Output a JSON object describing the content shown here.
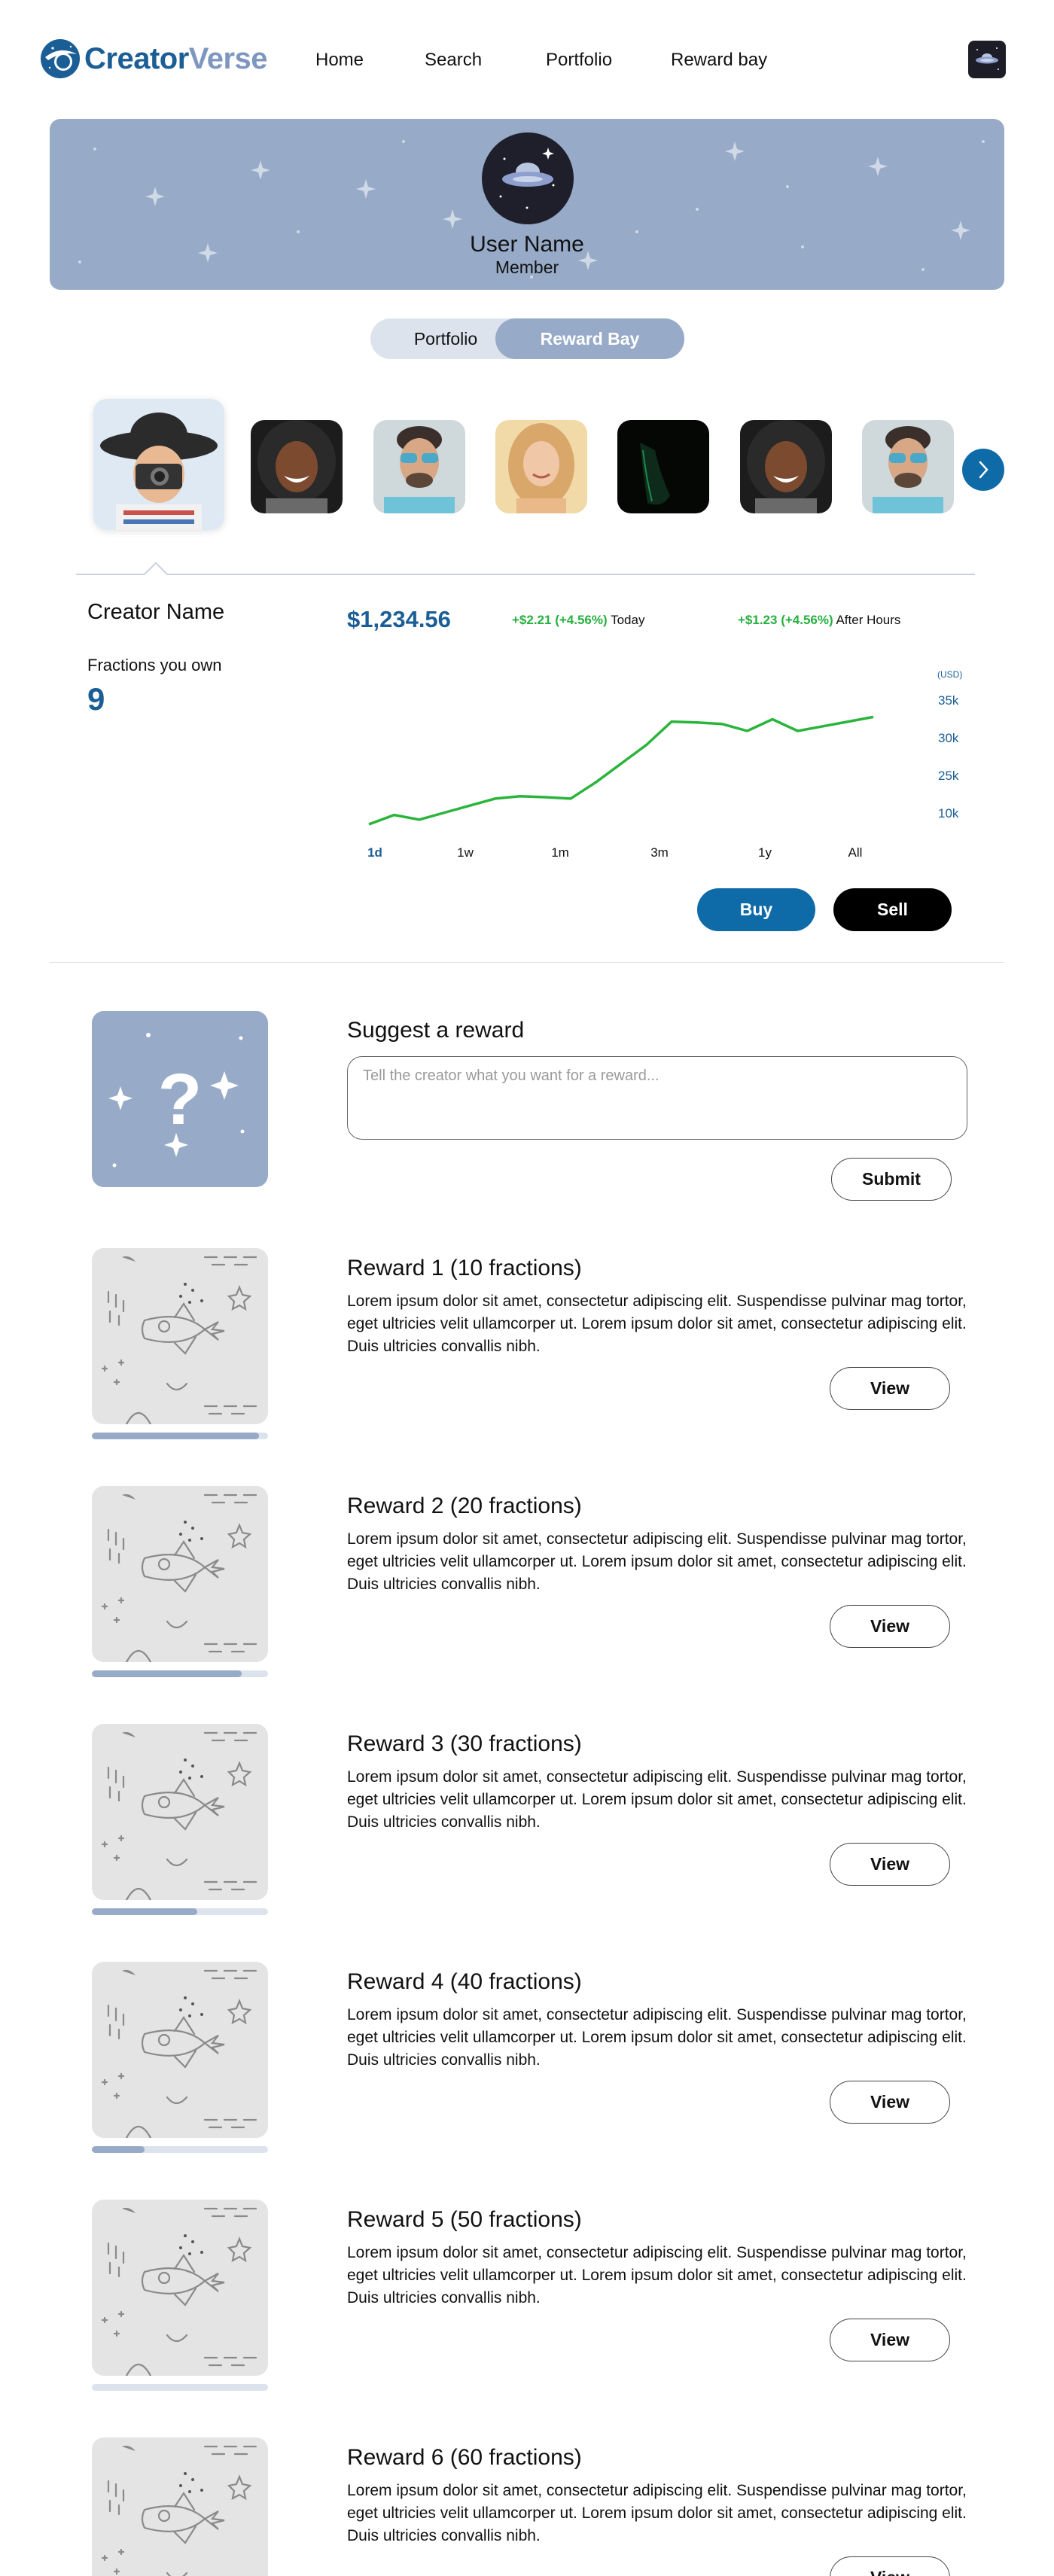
{
  "brand": {
    "name_part1": "Creator",
    "name_part2": "Verse",
    "logo_icon": "planet-logo-icon"
  },
  "nav": [
    {
      "label": "Home"
    },
    {
      "label": "Search"
    },
    {
      "label": "Portfolio"
    },
    {
      "label": "Reward bay"
    }
  ],
  "profile": {
    "name": "User Name",
    "role": "Member",
    "avatar_icon": "ufo-icon"
  },
  "toggle": {
    "left_label": "Portfolio",
    "right_label": "Reward Bay",
    "active": "Reward Bay"
  },
  "creators": [
    {
      "name": "creator-photographer-hat",
      "active": true
    },
    {
      "name": "creator-curly-hair-woman"
    },
    {
      "name": "creator-man-sunglasses"
    },
    {
      "name": "creator-blonde-woman"
    },
    {
      "name": "creator-dark-silhouette"
    },
    {
      "name": "creator-curly-hair-woman-2"
    },
    {
      "name": "creator-man-sunglasses-2"
    }
  ],
  "next_icon": "chevron-right-icon",
  "creator_detail": {
    "name": "Creator Name",
    "price": "$1,234.56",
    "today_change": "+$2.21 (+4.56%)",
    "today_label": "Today",
    "after_hours_change": "+$1.23 (+4.56%)",
    "after_hours_label": "After Hours",
    "fractions_label": "Fractions you own",
    "fractions_value": "9"
  },
  "chart_data": {
    "type": "line",
    "unit_label": "(USD)",
    "y_ticks": [
      "35k",
      "30k",
      "25k",
      "10k"
    ],
    "ranges": [
      "1d",
      "1w",
      "1m",
      "3m",
      "1y",
      "All"
    ],
    "active_range": "1d",
    "line_color": "#2bb43c",
    "values": [
      10,
      12,
      11,
      12.5,
      14,
      15.5,
      16,
      15.8,
      15.5,
      19,
      23,
      27,
      32,
      31.8,
      31.5,
      30,
      32.5,
      30,
      31,
      32,
      33
    ]
  },
  "actions": {
    "buy_label": "Buy",
    "sell_label": "Sell"
  },
  "suggest": {
    "title": "Suggest a reward",
    "placeholder": "Tell the creator what you want for a reward...",
    "submit_label": "Submit"
  },
  "rewards": [
    {
      "title": "Reward 1 (10 fractions)",
      "desc": "Lorem ipsum dolor sit amet, consectetur adipiscing elit. Suspendisse pulvinar mag tortor, eget ultricies velit ullamcorper ut. Lorem ipsum dolor sit amet, consectetur adipiscing elit. Duis ultricies convallis nibh.",
      "view_label": "View",
      "progress": 0.95
    },
    {
      "title": "Reward 2 (20 fractions)",
      "desc": "Lorem ipsum dolor sit amet, consectetur adipiscing elit. Suspendisse pulvinar mag tortor, eget ultricies velit ullamcorper ut. Lorem ipsum dolor sit amet, consectetur adipiscing elit. Duis ultricies convallis nibh.",
      "view_label": "View",
      "progress": 0.85
    },
    {
      "title": "Reward 3 (30 fractions)",
      "desc": "Lorem ipsum dolor sit amet, consectetur adipiscing elit. Suspendisse pulvinar mag tortor, eget ultricies velit ullamcorper ut. Lorem ipsum dolor sit amet, consectetur adipiscing elit. Duis ultricies convallis nibh.",
      "view_label": "View",
      "progress": 0.6
    },
    {
      "title": "Reward 4 (40 fractions)",
      "desc": "Lorem ipsum dolor sit amet, consectetur adipiscing elit. Suspendisse pulvinar mag tortor, eget ultricies velit ullamcorper ut. Lorem ipsum dolor sit amet, consectetur adipiscing elit. Duis ultricies convallis nibh.",
      "view_label": "View",
      "progress": 0.3
    },
    {
      "title": "Reward 5 (50 fractions)",
      "desc": "Lorem ipsum dolor sit amet, consectetur adipiscing elit. Suspendisse pulvinar mag tortor, eget ultricies velit ullamcorper ut. Lorem ipsum dolor sit amet, consectetur adipiscing elit. Duis ultricies convallis nibh.",
      "view_label": "View",
      "progress": 0.0
    },
    {
      "title": "Reward 6 (60 fractions)",
      "desc": "Lorem ipsum dolor sit amet, consectetur adipiscing elit. Suspendisse pulvinar mag tortor, eget ultricies velit ullamcorper ut. Lorem ipsum dolor sit amet, consectetur adipiscing elit. Duis ultricies convallis nibh.",
      "view_label": "View",
      "progress": 0.0
    }
  ]
}
